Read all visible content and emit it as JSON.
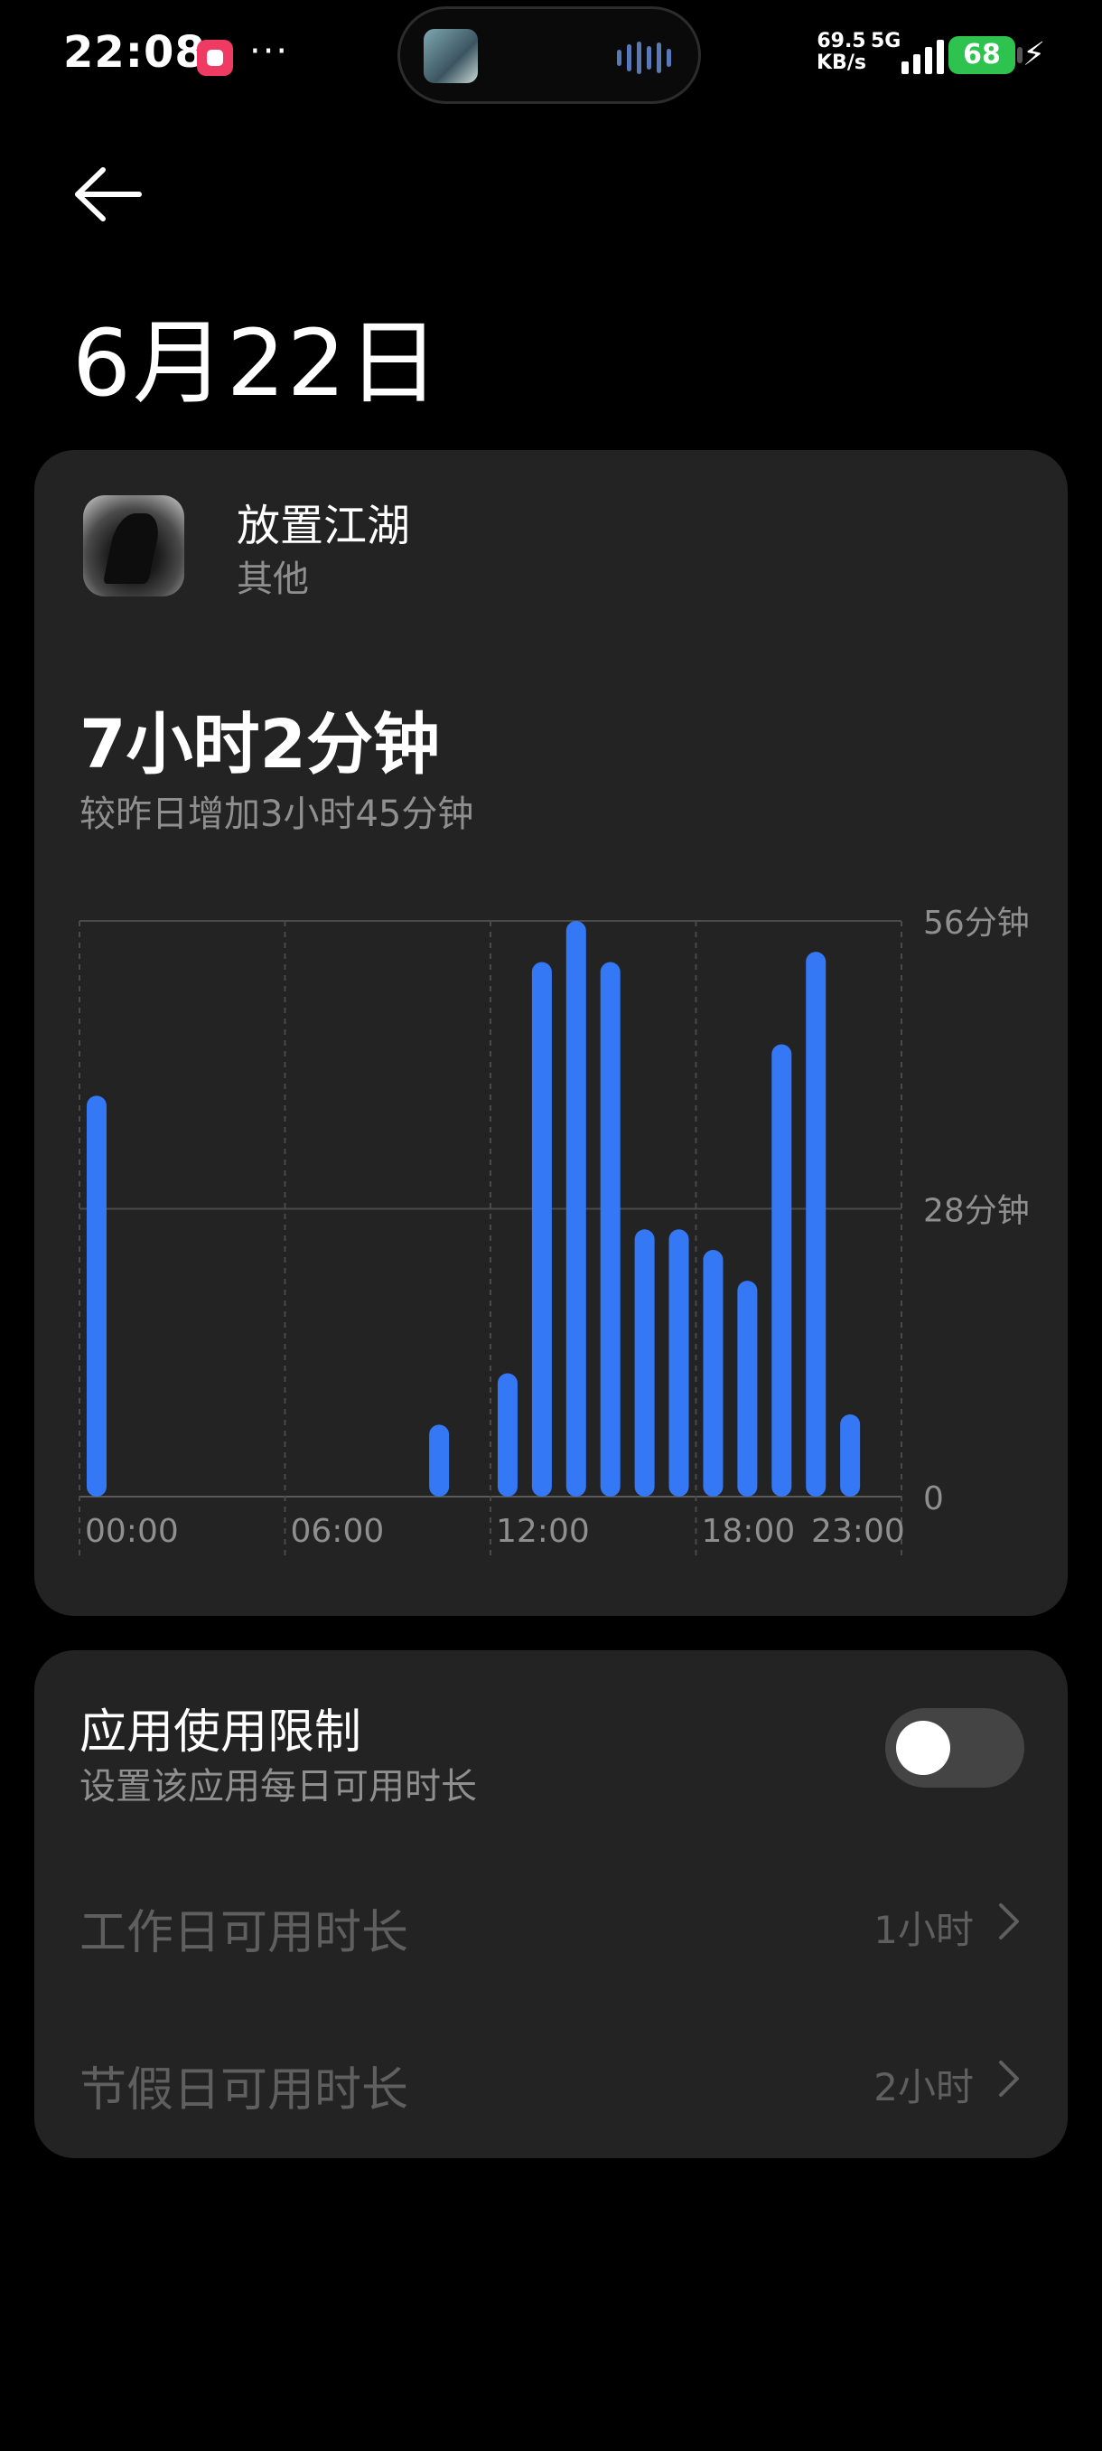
{
  "status_bar": {
    "time": "22:08",
    "more": "···",
    "net_speed_value": "69.5",
    "net_speed_unit": "KB/s",
    "network_type": "5G",
    "battery": "68"
  },
  "header": {
    "title": "6月22日"
  },
  "app": {
    "name": "放置江湖",
    "category": "其他",
    "total_time": "7小时2分钟",
    "compare_text": "较昨日增加3小时45分钟"
  },
  "chart_data": {
    "type": "bar",
    "x_unit": "hour",
    "x_tick_labels": [
      "00:00",
      "06:00",
      "12:00",
      "18:00",
      "23:00"
    ],
    "y_tick_labels": [
      "56分钟",
      "28分钟",
      "0"
    ],
    "ylim": [
      0,
      56
    ],
    "grid": true,
    "x": [
      0,
      10,
      12,
      13,
      14,
      15,
      16,
      17,
      18,
      19,
      20,
      21,
      22
    ],
    "values": [
      39,
      7,
      12,
      52,
      56,
      52,
      26,
      26,
      24,
      21,
      44,
      53,
      8
    ],
    "bar_color": "#3478f6"
  },
  "limits": {
    "title": "应用使用限制",
    "subtitle": "设置该应用每日可用时长",
    "enabled": false,
    "workday_label": "工作日可用时长",
    "workday_value": "1小时",
    "holiday_label": "节假日可用时长",
    "holiday_value": "2小时"
  }
}
